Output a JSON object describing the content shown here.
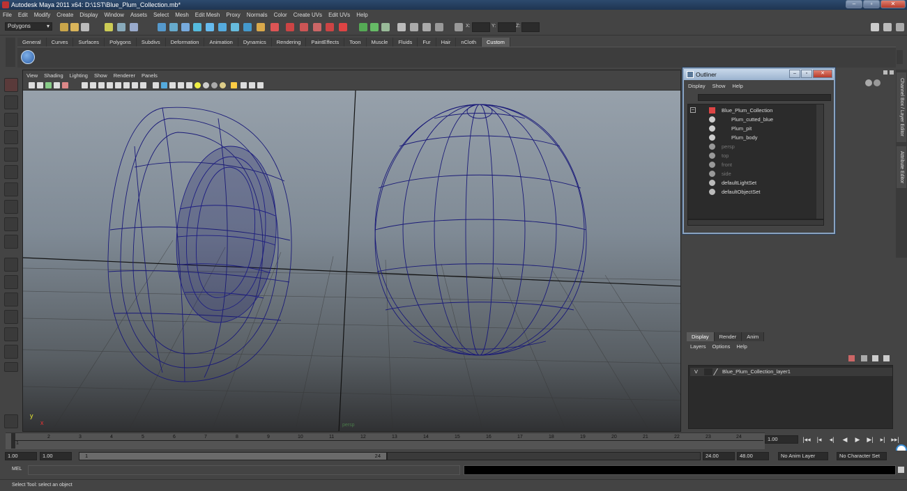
{
  "window": {
    "title": "Autodesk Maya 2011 x64: D:\\1ST\\Blue_Plum_Collection.mb*",
    "controls": [
      "‒",
      "▫",
      "✕"
    ]
  },
  "menubar": [
    "File",
    "Edit",
    "Modify",
    "Create",
    "Display",
    "Window",
    "Assets",
    "Select",
    "Mesh",
    "Edit Mesh",
    "Proxy",
    "Normals",
    "Color",
    "Create UVs",
    "Edit UVs",
    "Help"
  ],
  "statusline": {
    "mode": "Polygons",
    "x_label": "X:",
    "y_label": "Y:",
    "z_label": "Z:"
  },
  "shelf": {
    "tabs": [
      "General",
      "Curves",
      "Surfaces",
      "Polygons",
      "Subdivs",
      "Deformation",
      "Animation",
      "Dynamics",
      "Rendering",
      "PaintEffects",
      "Toon",
      "Muscle",
      "Fluids",
      "Fur",
      "Hair",
      "nCloth",
      "Custom"
    ],
    "active_tab": "Custom"
  },
  "viewport": {
    "menu": [
      "View",
      "Shading",
      "Lighting",
      "Show",
      "Renderer",
      "Panels"
    ],
    "camera_label": "persp",
    "axis_y": "y",
    "axis_x": "x",
    "wire_color": "#1a1a78"
  },
  "outliner": {
    "title": "Outliner",
    "menu": [
      "Display",
      "Show",
      "Help"
    ],
    "items": [
      {
        "label": "Blue_Plum_Collection",
        "dim": false,
        "indent": 0
      },
      {
        "label": "Plum_cutted_blue",
        "dim": false,
        "indent": 1
      },
      {
        "label": "Plum_pit",
        "dim": false,
        "indent": 1
      },
      {
        "label": "Plum_body",
        "dim": false,
        "indent": 1
      },
      {
        "label": "persp",
        "dim": true,
        "indent": 0
      },
      {
        "label": "top",
        "dim": true,
        "indent": 0
      },
      {
        "label": "front",
        "dim": true,
        "indent": 0
      },
      {
        "label": "side",
        "dim": true,
        "indent": 0
      },
      {
        "label": "defaultLightSet",
        "dim": false,
        "indent": 0
      },
      {
        "label": "defaultObjectSet",
        "dim": false,
        "indent": 0
      }
    ]
  },
  "side_tabs": [
    "Channel Box / Layer Editor",
    "Attribute Editor"
  ],
  "layers": {
    "tabs": [
      "Display",
      "Render",
      "Anim"
    ],
    "active_tab": "Display",
    "menu": [
      "Layers",
      "Options",
      "Help"
    ],
    "rows": [
      {
        "visible": "V",
        "name": "Blue_Plum_Collection_layer1"
      }
    ]
  },
  "timeline": {
    "ticks": [
      "1",
      "2",
      "3",
      "4",
      "5",
      "6",
      "7",
      "8",
      "9",
      "10",
      "11",
      "12",
      "13",
      "14",
      "15",
      "16",
      "17",
      "18",
      "19",
      "20",
      "21",
      "22",
      "23",
      "24"
    ],
    "current_frame": "1.00",
    "playback": [
      "|◂◂",
      "|◂",
      "◂|",
      "◀",
      "▶",
      "▶|",
      "▸|",
      "▸▸|"
    ]
  },
  "range": {
    "start_field": "1.00",
    "start_inner": "1.00",
    "slider_start": "1",
    "slider_end": "24",
    "end_inner": "24.00",
    "end_field": "48.00",
    "anim_layer": "No Anim Layer",
    "char_set": "No Character Set"
  },
  "mel": {
    "label": "MEL"
  },
  "help_line": "Select Tool: select an object"
}
